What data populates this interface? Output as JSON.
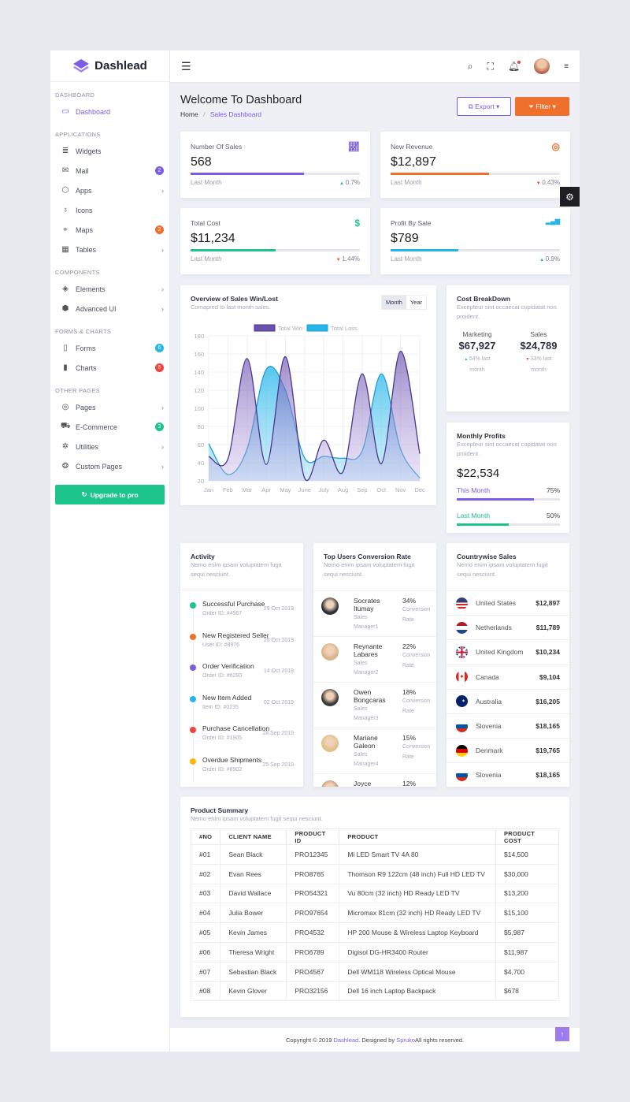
{
  "app": {
    "name": "Dashlead"
  },
  "colors": {
    "purple": "#7b5ce5",
    "orange": "#f06f2b",
    "green": "#1dc48b",
    "cyan": "#24b6ea",
    "red": "#f0433c",
    "yellow": "#f5b80c"
  },
  "sidebar": {
    "sections": [
      {
        "title": "DASHBOARD",
        "items": [
          {
            "label": "Dashboard",
            "icon": "monitor-icon",
            "active": true
          }
        ]
      },
      {
        "title": "APPLICATIONS",
        "items": [
          {
            "label": "Widgets",
            "icon": "database-icon"
          },
          {
            "label": "Mail",
            "icon": "mail-icon",
            "badge": "2",
            "badge_color": "#7b5ce5"
          },
          {
            "label": "Apps",
            "icon": "box-icon",
            "chevron": true
          },
          {
            "label": "Icons",
            "icon": "award-icon"
          },
          {
            "label": "Maps",
            "icon": "map-pin-icon",
            "badge": "2",
            "badge_color": "#f06f2b"
          },
          {
            "label": "Tables",
            "icon": "layout-icon",
            "chevron": true
          }
        ]
      },
      {
        "title": "COMPONENTS",
        "items": [
          {
            "label": "Elements",
            "icon": "layers-icon",
            "chevron": true
          },
          {
            "label": "Advanced UI",
            "icon": "package-icon",
            "chevron": true
          }
        ]
      },
      {
        "title": "FORMS & CHARTS",
        "items": [
          {
            "label": "Forms",
            "icon": "file-icon",
            "badge": "6",
            "badge_color": "#24b6ea"
          },
          {
            "label": "Charts",
            "icon": "bar-chart-icon",
            "badge": "5",
            "badge_color": "#f0433c"
          }
        ]
      },
      {
        "title": "OTHER PAGES",
        "items": [
          {
            "label": "Pages",
            "icon": "compass-icon",
            "chevron": true
          },
          {
            "label": "E-Commerce",
            "icon": "cart-icon",
            "badge": "3",
            "badge_color": "#1dc48b"
          },
          {
            "label": "Utilities",
            "icon": "settings-icon",
            "chevron": true
          },
          {
            "label": "Custom Pages",
            "icon": "aperture-icon",
            "chevron": true
          }
        ]
      }
    ],
    "upgrade_label": "Upgrade to pro"
  },
  "page": {
    "title": "Welcome To Dashboard",
    "breadcrumb": [
      "Home",
      "Sales Dashboard"
    ],
    "export_label": "Export",
    "filter_label": "Filter"
  },
  "stats": [
    {
      "label": "Number Of Sales",
      "value": "568",
      "progress": 0.67,
      "color": "#7b5ce5",
      "period": "Last Month",
      "change": "0.7%",
      "trend": "up",
      "icon": "line-chart-icon"
    },
    {
      "label": "New Revenue",
      "value": "$12,897",
      "progress": 0.58,
      "color": "#f06f2b",
      "period": "Last Month",
      "change": "0.43%",
      "trend": "down",
      "icon": "target-icon"
    },
    {
      "label": "Total Cost",
      "value": "$11,234",
      "progress": 0.5,
      "color": "#1dc48b",
      "period": "Last Month",
      "change": "1.44%",
      "trend": "down",
      "icon": "dollar-icon"
    },
    {
      "label": "Profit By Sale",
      "value": "$789",
      "progress": 0.4,
      "color": "#24b6ea",
      "period": "Last Month",
      "change": "0.9%",
      "trend": "up",
      "icon": "signal-icon"
    }
  ],
  "chart_data": {
    "type": "area",
    "title": "Overview of Sales Win/Lost",
    "subtitle": "Comapred to last month sales.",
    "toggle": [
      "Month",
      "Year"
    ],
    "categories": [
      "Jan",
      "Feb",
      "Mar",
      "Apr",
      "May",
      "June",
      "July",
      "Aug",
      "Sep",
      "Oct",
      "Nov",
      "Dec"
    ],
    "ylim": [
      20,
      180
    ],
    "yticks": [
      20,
      40,
      60,
      80,
      100,
      120,
      140,
      160,
      180
    ],
    "grid": true,
    "legend": "top",
    "series": [
      {
        "name": "Total Win",
        "color": "#6a4fb0",
        "values": [
          47,
          44,
          155,
          38,
          157,
          23,
          65,
          30,
          138,
          39,
          163,
          50
        ]
      },
      {
        "name": "Total Loss",
        "color": "#24b6ea",
        "values": [
          61,
          27,
          55,
          143,
          120,
          45,
          47,
          45,
          53,
          138,
          55,
          23
        ]
      }
    ]
  },
  "cost": {
    "title": "Cost BreakDown",
    "subtitle": "Excepteur sint occaecat cupidatat non proident.",
    "items": [
      {
        "label": "Marketing",
        "value": "$67,927",
        "note": "54% last month",
        "trend": "up",
        "color": "#f06f2b",
        "fill": 0.54
      },
      {
        "label": "Sales",
        "value": "$24,789",
        "note": "33% last month",
        "trend": "down",
        "color": "#24b6ea",
        "fill": 0.33
      }
    ]
  },
  "profits": {
    "title": "Monthly Profits",
    "subtitle": "Excepteur sint occaecat cupidatat non proident.",
    "value": "$22,534",
    "rows": [
      {
        "label": "This Month",
        "pct": "75%",
        "fill": 0.75,
        "color": "#7b5ce5"
      },
      {
        "label": "Last Month",
        "pct": "50%",
        "fill": 0.5,
        "color": "#1dc48b"
      }
    ]
  },
  "activity": {
    "title": "Activity",
    "subtitle": "Nemo enim ipsam voluptatem fugit sequi nesciunt.",
    "items": [
      {
        "title": "Successful Purchase",
        "sub": "Order ID: #4567",
        "date": "29 Oct 2019",
        "color": "#1dc48b"
      },
      {
        "title": "New Registered Seller",
        "sub": "User ID: #8976",
        "date": "25 Oct 2019",
        "color": "#f06f2b"
      },
      {
        "title": "Order Verification",
        "sub": "Order ID: #6290",
        "date": "14 Oct 2019",
        "color": "#7b5ce5"
      },
      {
        "title": "New Item Added",
        "sub": "Item ID: #0235",
        "date": "02 Oct 2019",
        "color": "#24b6ea"
      },
      {
        "title": "Purchase Cancellation",
        "sub": "Order ID: #1905",
        "date": "28 Sep 2019",
        "color": "#f0433c"
      },
      {
        "title": "Overdue Shipments",
        "sub": "Order ID: #8902",
        "date": "25 Sep 2019",
        "color": "#f5b80c"
      }
    ]
  },
  "users": {
    "title": "Top Users Conversion Rate",
    "subtitle": "Nemo enim ipsam voluptatem fugit sequi nesciunt.",
    "items": [
      {
        "name": "Socrates Itumay",
        "role": "Sales Manager1",
        "pct": "34%",
        "label": "Conversion Rate"
      },
      {
        "name": "Reynante Labares",
        "role": "Sales Manager2",
        "pct": "22%",
        "label": "Conversion Rate"
      },
      {
        "name": "Owen Bongcaras",
        "role": "Sales Manager3",
        "pct": "18%",
        "label": "Conversion Rate"
      },
      {
        "name": "Mariane Galeon",
        "role": "Sales Manager4",
        "pct": "15%",
        "label": "Conversion Rate"
      },
      {
        "name": "Joyce",
        "role": "",
        "pct": "12%",
        "label": ""
      }
    ]
  },
  "countries": {
    "title": "Countrywise Sales",
    "subtitle": "Nemo enim ipsam voluptatem fugit sequi nesciunt.",
    "items": [
      {
        "name": "United States",
        "value": "$12,897",
        "flag": "us"
      },
      {
        "name": "Netherlands",
        "value": "$11,789",
        "flag": "nl"
      },
      {
        "name": "United Kingdom",
        "value": "$10,234",
        "flag": "uk"
      },
      {
        "name": "Canada",
        "value": "$9,104",
        "flag": "ca"
      },
      {
        "name": "Australia",
        "value": "$16,205",
        "flag": "au"
      },
      {
        "name": "Slovenia",
        "value": "$18,165",
        "flag": "si"
      },
      {
        "name": "Denmark",
        "value": "$19,765",
        "flag": "de"
      },
      {
        "name": "Slovenia",
        "value": "$18,165",
        "flag": "si"
      }
    ]
  },
  "products": {
    "title": "Product Summary",
    "subtitle": "Nemo enim ipsam voluptatem fugit sequi nesciunt.",
    "columns": [
      "#NO",
      "CLIENT NAME",
      "PRODUCT ID",
      "PRODUCT",
      "PRODUCT COST"
    ],
    "rows": [
      [
        "#01",
        "Sean Black",
        "PRO12345",
        "Mi LED Smart TV 4A 80",
        "$14,500"
      ],
      [
        "#02",
        "Evan Rees",
        "PRO8765",
        "Thomson R9 122cm (48 inch) Full HD LED TV",
        "$30,000"
      ],
      [
        "#03",
        "David Wallace",
        "PRO54321",
        "Vu 80cm (32 inch) HD Ready LED TV",
        "$13,200"
      ],
      [
        "#04",
        "Julia Bower",
        "PRO97654",
        "Micromax 81cm (32 inch) HD Ready LED TV",
        "$15,100"
      ],
      [
        "#05",
        "Kevin James",
        "PRO4532",
        "HP 200 Mouse & Wireless Laptop Keyboard",
        "$5,987"
      ],
      [
        "#06",
        "Theresa Wright",
        "PRO6789",
        "Digisol DG-HR3400 Router",
        "$11,987"
      ],
      [
        "#07",
        "Sebastian Black",
        "PRO4567",
        "Dell WM118 Wireless Optical Mouse",
        "$4,700"
      ],
      [
        "#08",
        "Kevin Glover",
        "PRO32156",
        "Dell 16 inch Laptop Backpack",
        "$678"
      ]
    ]
  },
  "footer": {
    "prefix": "Copyright © 2019 ",
    "brand": "Dashlead",
    "middle": ". Designed by ",
    "designer": "Spruko",
    "suffix": " All rights reserved."
  }
}
